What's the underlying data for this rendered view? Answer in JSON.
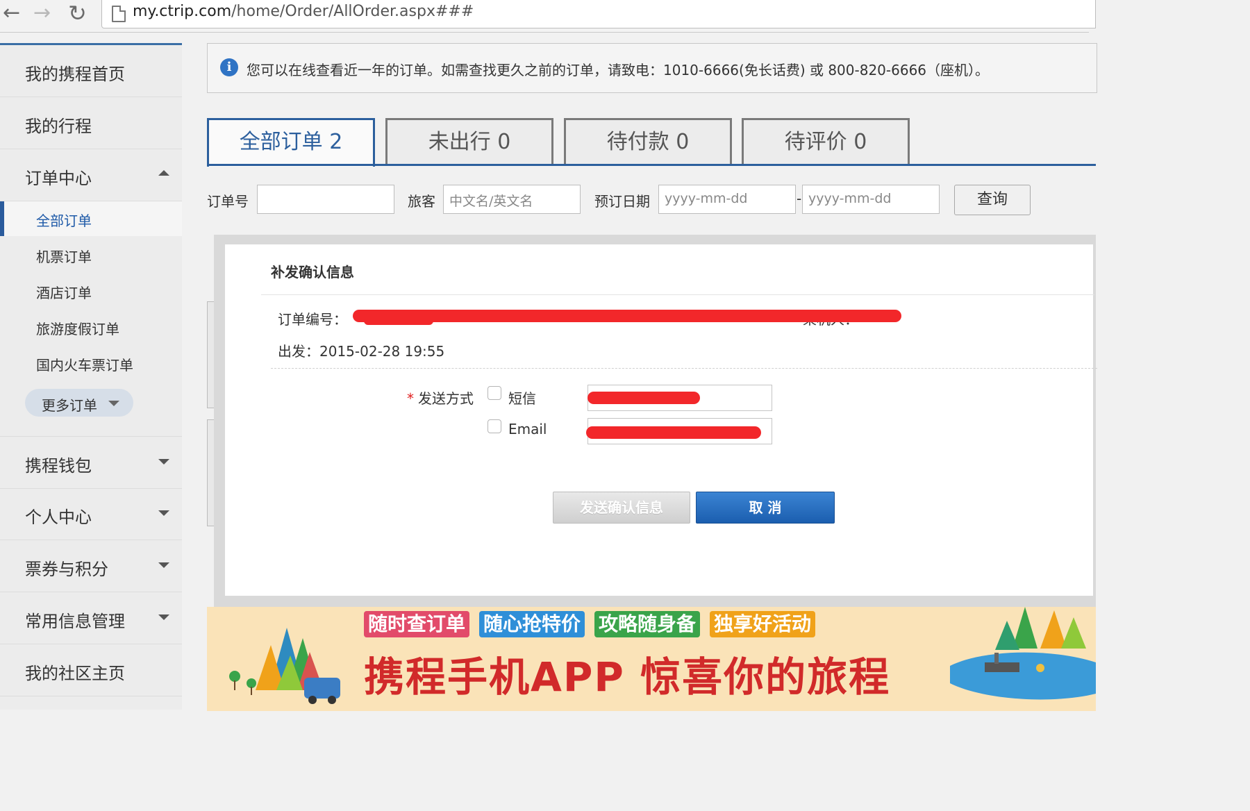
{
  "browser": {
    "back_icon": "arrow-left-icon",
    "forward_icon": "arrow-right-icon",
    "reload_icon": "reload-icon",
    "url_host": "my.ctrip.com",
    "url_path": "/home/Order/AllOrder.aspx###"
  },
  "sidebar": {
    "items": [
      {
        "label": "我的携程首页"
      },
      {
        "label": "我的行程"
      },
      {
        "label": "订单中心"
      },
      {
        "label": "携程钱包"
      },
      {
        "label": "个人中心"
      },
      {
        "label": "票券与积分"
      },
      {
        "label": "常用信息管理"
      },
      {
        "label": "我的社区主页"
      }
    ],
    "sub_items": [
      {
        "label": "全部订单",
        "active": true
      },
      {
        "label": "机票订单"
      },
      {
        "label": "酒店订单"
      },
      {
        "label": "旅游度假订单"
      },
      {
        "label": "国内火车票订单"
      }
    ],
    "more_label": "更多订单"
  },
  "info": {
    "text": "您可以在线查看近一年的订单。如需查找更久之前的订单，请致电：1010-6666(免长话费) 或 800-820-6666（座机）。"
  },
  "tabs": [
    {
      "label": "全部订单 2",
      "active": true
    },
    {
      "label": "未出行 0"
    },
    {
      "label": "待付款 0"
    },
    {
      "label": "待评价 0"
    }
  ],
  "filters": {
    "order_no_label": "订单号",
    "traveler_label": "旅客",
    "traveler_placeholder": "中文名/英文名",
    "date_label": "预订日期",
    "date_from_placeholder": "yyyy-mm-dd",
    "date_separator": "-",
    "date_to_placeholder": "yyyy-mm-dd",
    "query_label": "查询"
  },
  "modal": {
    "title": "补发确认信息",
    "order_no_label": "订单编号：",
    "passenger_label": "乘机人：",
    "depart_label": "出发：",
    "depart_value": "2015-02-28 19:55",
    "send_method_label": "发送方式",
    "required_mark": "*",
    "option_sms": "短信",
    "option_email": "Email",
    "send_button": "发送确认信息",
    "cancel_button": "取 消"
  },
  "banner": {
    "pills": [
      {
        "label": "随时查订单",
        "color": "#e24b6a"
      },
      {
        "label": "随心抢特价",
        "color": "#2f8fd8"
      },
      {
        "label": "攻略随身备",
        "color": "#3aa44a"
      },
      {
        "label": "独享好活动",
        "color": "#f0a21a"
      }
    ],
    "slogan": "携程手机APP 惊喜你的旅程"
  },
  "colors": {
    "accent": "#2c5f9d",
    "redaction": "#f2272a",
    "banner_bg": "#fae3b8"
  }
}
